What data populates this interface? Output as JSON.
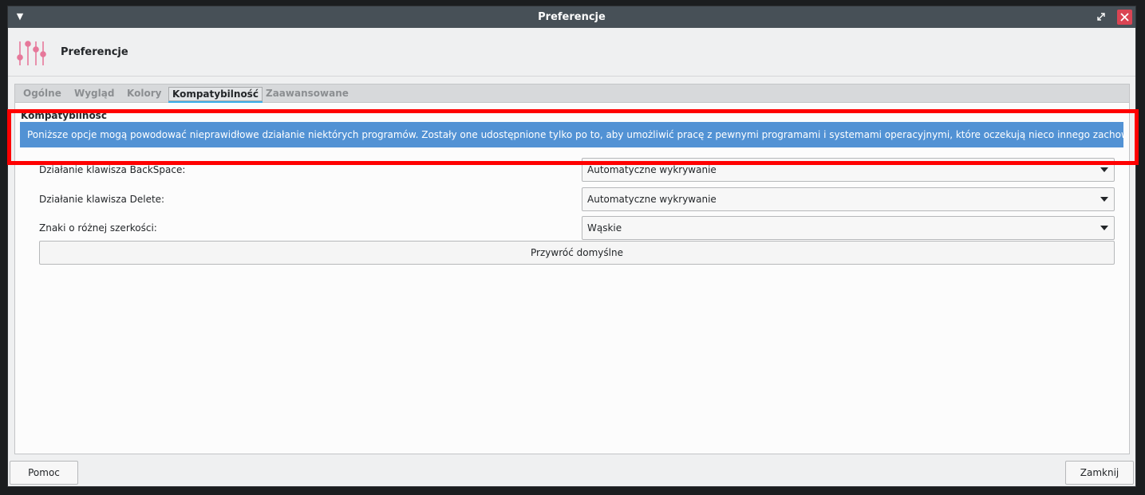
{
  "window": {
    "title": "Preferencje"
  },
  "header": {
    "title": "Preferencje",
    "icon": "sliders-icon"
  },
  "tabs": [
    {
      "label": "Ogólne",
      "active": false
    },
    {
      "label": "Wygląd",
      "active": false
    },
    {
      "label": "Kolory",
      "active": false
    },
    {
      "label": "Kompatybilność",
      "active": true
    },
    {
      "label": "Zaawansowane",
      "active": false
    }
  ],
  "compat": {
    "group_title": "Kompatybilność",
    "info_text": "Poniższe opcje mogą powodować nieprawidłowe działanie niektórych programów. Zostały one udostępnione  tylko po to, aby umożliwić pracę z pewnymi programami i systemami operacyjnymi, które oczekują nieco innego zachowania terminala.",
    "rows": [
      {
        "label": "Działanie klawisza BackSpace:",
        "value": "Automatyczne wykrywanie"
      },
      {
        "label": "Działanie klawisza Delete:",
        "value": "Automatyczne wykrywanie"
      },
      {
        "label": "Znaki o różnej szerkości:",
        "value": "Wąskie"
      }
    ],
    "reset_label": "Przywróć domyślne"
  },
  "footer": {
    "help_label": "Pomoc",
    "close_label": "Zamknij"
  },
  "colors": {
    "titlebar": "#475057",
    "accent": "#3daee9",
    "info_bg": "#5292d4",
    "icon_pink": "#e6789a",
    "highlight": "#ff0000",
    "close": "#da4453"
  }
}
